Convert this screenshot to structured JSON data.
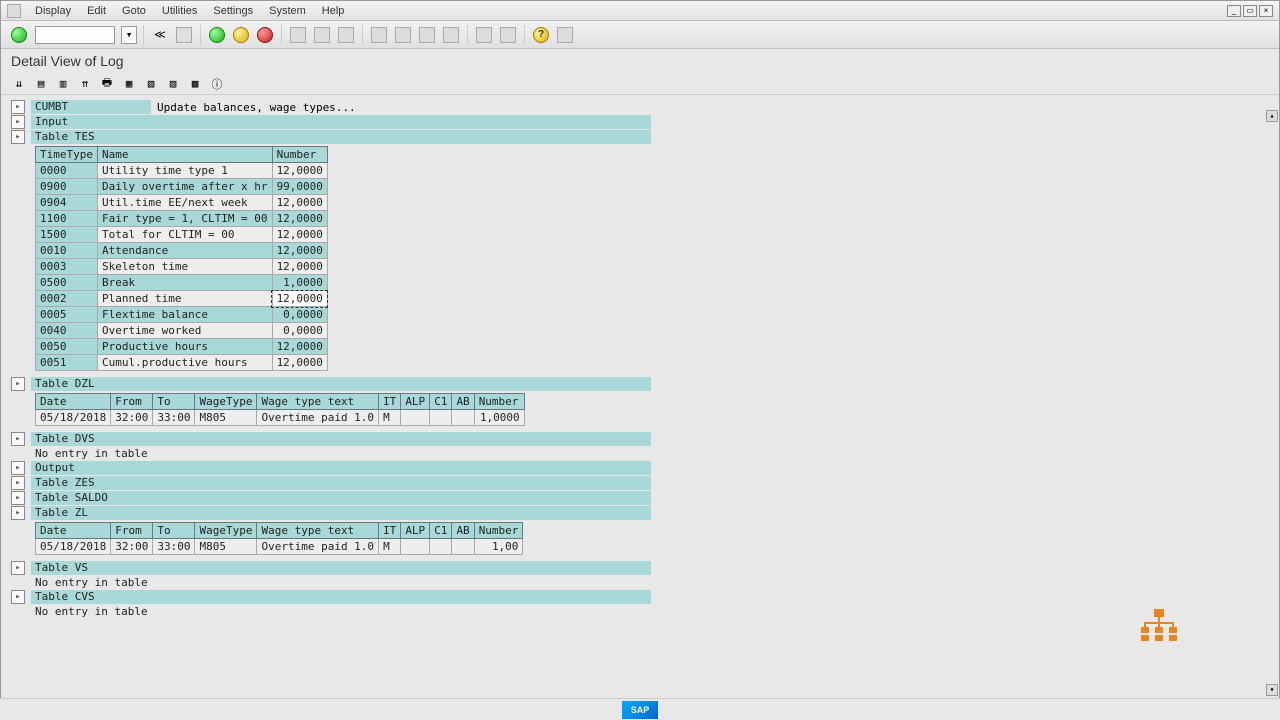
{
  "menu": {
    "items": [
      "Display",
      "Edit",
      "Goto",
      "Utilities",
      "Settings",
      "System",
      "Help"
    ]
  },
  "title": "Detail View of Log",
  "section_cumbt": {
    "name": "CUMBT",
    "desc": "Update balances, wage types..."
  },
  "section_input": "Input",
  "section_tes": "Table TES",
  "tes": {
    "cols": [
      "TimeType",
      "Name",
      "Number"
    ],
    "rows": [
      {
        "tt": "0000",
        "name": "Utility time type 1",
        "num": "12,0000",
        "hl": false
      },
      {
        "tt": "0900",
        "name": "Daily overtime after x hr",
        "num": "99,0000",
        "hl": true
      },
      {
        "tt": "0904",
        "name": "Util.time EE/next week",
        "num": "12,0000",
        "hl": false
      },
      {
        "tt": "1100",
        "name": "Fair type = 1, CLTIM = 00",
        "num": "12,0000",
        "hl": true
      },
      {
        "tt": "1500",
        "name": "Total for CLTIM = 00",
        "num": "12,0000",
        "hl": false
      },
      {
        "tt": "0010",
        "name": "Attendance",
        "num": "12,0000",
        "hl": true
      },
      {
        "tt": "0003",
        "name": "Skeleton time",
        "num": "12,0000",
        "hl": false
      },
      {
        "tt": "0500",
        "name": "Break",
        "num": "1,0000",
        "hl": true
      },
      {
        "tt": "0002",
        "name": "Planned time",
        "num": "12,0000",
        "hl": false,
        "sel": true
      },
      {
        "tt": "0005",
        "name": "Flextime balance",
        "num": "0,0000",
        "hl": true
      },
      {
        "tt": "0040",
        "name": "Overtime worked",
        "num": "0,0000",
        "hl": false
      },
      {
        "tt": "0050",
        "name": "Productive hours",
        "num": "12,0000",
        "hl": true
      },
      {
        "tt": "0051",
        "name": "Cumul.productive hours",
        "num": "12,0000",
        "hl": false
      }
    ]
  },
  "section_dzl": "Table DZL",
  "dzl": {
    "cols": [
      "Date",
      "From",
      "To",
      "WageType",
      "Wage type text",
      "IT",
      "ALP",
      "C1",
      "AB",
      "Number"
    ],
    "row": {
      "date": "05/18/2018",
      "from": "32:00",
      "to": "33:00",
      "wt": "M805",
      "wtt": "Overtime paid 1.0",
      "it": "M",
      "alp": "",
      "c1": "",
      "ab": "",
      "num": "1,0000"
    }
  },
  "section_dvs": "Table DVS",
  "no_entry": "No entry in table",
  "section_output": "Output",
  "section_zes": "Table ZES",
  "section_saldo": "Table SALDO",
  "section_zl": "Table ZL",
  "zl": {
    "cols": [
      "Date",
      "From",
      "To",
      "WageType",
      "Wage type text",
      "IT",
      "ALP",
      "C1",
      "AB",
      "Number"
    ],
    "row": {
      "date": "05/18/2018",
      "from": "32:00",
      "to": "33:00",
      "wt": "M805",
      "wtt": "Overtime paid 1.0",
      "it": "M",
      "alp": "",
      "c1": "",
      "ab": "",
      "num": "1,00"
    }
  },
  "section_vs": "Table VS",
  "section_cvs": "Table CVS",
  "sap": "SAP"
}
